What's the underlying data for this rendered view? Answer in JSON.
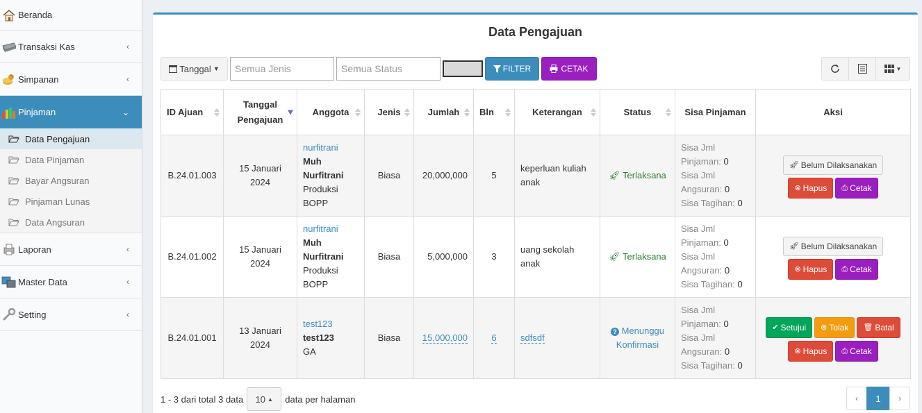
{
  "sidebar": {
    "items": [
      {
        "label": "Beranda",
        "icon": "home-icon"
      },
      {
        "label": "Transaksi Kas",
        "icon": "cash-register-icon"
      },
      {
        "label": "Simpanan",
        "icon": "savings-icon"
      },
      {
        "label": "Pinjaman",
        "icon": "loan-icon"
      },
      {
        "label": "Laporan",
        "icon": "report-icon"
      },
      {
        "label": "Master Data",
        "icon": "master-data-icon"
      },
      {
        "label": "Setting",
        "icon": "wrench-icon"
      }
    ],
    "submenu": [
      {
        "label": "Data Pengajuan"
      },
      {
        "label": "Data Pinjaman"
      },
      {
        "label": "Bayar Angsuran"
      },
      {
        "label": "Pinjaman Lunas"
      },
      {
        "label": "Data Angsuran"
      }
    ]
  },
  "main": {
    "title": "Data Pengajuan",
    "toolbar": {
      "date_label": "Tanggal",
      "jenis_placeholder": "Semua Jenis",
      "status_placeholder": "Semua Status",
      "filter_label": "FILTER",
      "cetak_label": "CETAK"
    },
    "columns": [
      "ID Ajuan",
      "Tanggal Pengajuan",
      "Anggota",
      "Jenis",
      "Jumlah",
      "Bln",
      "Keterangan",
      "Status",
      "Sisa Pinjaman",
      "Aksi"
    ],
    "rows": [
      {
        "id": "B.24.01.003",
        "date_line1": "15 Januari",
        "date_line2": "2024",
        "username": "nurfitrani",
        "name_line1": "Muh",
        "name_line2": "Nurfitrani",
        "dept_line1": "Produksi",
        "dept_line2": "BOPP",
        "jenis": "Biasa",
        "jumlah": "20,000,000",
        "bln": "5",
        "keterangan": "keperluan kuliah anak",
        "status": "Terlaksana",
        "sisa_jml_pinjaman_label": "Sisa Jml Pinjaman:",
        "sisa_jml_pinjaman": "0",
        "sisa_jml_angsuran_label": "Sisa Jml Angsuran:",
        "sisa_jml_angsuran": "0",
        "sisa_tagihan_label": "Sisa Tagihan:",
        "sisa_tagihan": "0",
        "btn_belum": "Belum Dilaksanakan",
        "btn_hapus": "Hapus",
        "btn_cetak": "Cetak"
      },
      {
        "id": "B.24.01.002",
        "date_line1": "15 Januari",
        "date_line2": "2024",
        "username": "nurfitrani",
        "name_line1": "Muh",
        "name_line2": "Nurfitrani",
        "dept_line1": "Produksi",
        "dept_line2": "BOPP",
        "jenis": "Biasa",
        "jumlah": "5,000,000",
        "bln": "3",
        "keterangan": "uang sekolah anak",
        "status": "Terlaksana",
        "sisa_jml_pinjaman_label": "Sisa Jml Pinjaman:",
        "sisa_jml_pinjaman": "0",
        "sisa_jml_angsuran_label": "Sisa Jml Angsuran:",
        "sisa_jml_angsuran": "0",
        "sisa_tagihan_label": "Sisa Tagihan:",
        "sisa_tagihan": "0",
        "btn_belum": "Belum Dilaksanakan",
        "btn_hapus": "Hapus",
        "btn_cetak": "Cetak"
      },
      {
        "id": "B.24.01.001",
        "date_line1": "13 Januari",
        "date_line2": "2024",
        "username": "test123",
        "name_line1": "test123",
        "dept_line1": "GA",
        "jenis": "Biasa",
        "jumlah": "15,000,000",
        "bln": "6",
        "keterangan": "sdfsdf",
        "status": "Menunggu Konfirmasi",
        "sisa_jml_pinjaman_label": "Sisa Jml Pinjaman:",
        "sisa_jml_pinjaman": "0",
        "sisa_jml_angsuran_label": "Sisa Jml Angsuran:",
        "sisa_jml_angsuran": "0",
        "sisa_tagihan_label": "Sisa Tagihan:",
        "sisa_tagihan": "0",
        "btn_setujui": "Setujui",
        "btn_tolak": "Tolak",
        "btn_batal": "Batal",
        "btn_hapus": "Hapus",
        "btn_cetak": "Cetak"
      }
    ],
    "footer": {
      "info": "1 - 3 dari total 3 data",
      "page_size": "10",
      "per_page_label": "data per halaman",
      "prev": "‹",
      "current_page": "1",
      "next": "›"
    }
  },
  "colors": {
    "primary": "#3c8dbc",
    "purple": "#9b1fbf",
    "danger": "#dd4b39",
    "success": "#00a65a",
    "warning": "#f39c12"
  }
}
